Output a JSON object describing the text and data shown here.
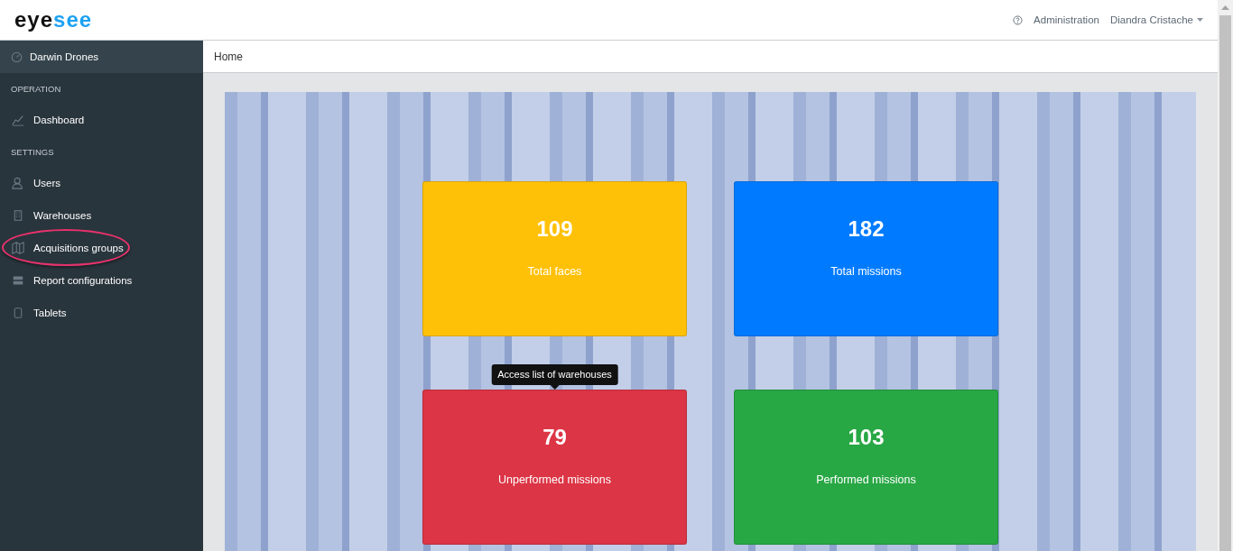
{
  "header": {
    "logo": {
      "dark": "eye",
      "accent": "see"
    },
    "links": [
      "Administration"
    ],
    "user": "Diandra Cristache"
  },
  "sidebar": {
    "organization": "Darwin Drones",
    "items": [
      {
        "kind": "section",
        "label": "OPERATION"
      },
      {
        "kind": "link",
        "label": "Dashboard",
        "highlighted": false
      },
      {
        "kind": "section",
        "label": "SETTINGS"
      },
      {
        "kind": "link",
        "label": "Users",
        "highlighted": false
      },
      {
        "kind": "link",
        "label": "Warehouses",
        "highlighted": false
      },
      {
        "kind": "link",
        "label": "Acquisitions groups",
        "highlighted": true
      },
      {
        "kind": "link",
        "label": "Report configurations",
        "highlighted": false
      },
      {
        "kind": "link",
        "label": "Tablets",
        "highlighted": false
      }
    ]
  },
  "breadcrumb": "Home",
  "cards": [
    {
      "value": "109",
      "label": "Total faces",
      "color": "#ffc107"
    },
    {
      "value": "182",
      "label": "Total missions",
      "color": "#007bff"
    },
    {
      "value": "79",
      "label": "Unperformed missions",
      "color": "#dc3545",
      "tooltip": "Access list of warehouses"
    },
    {
      "value": "103",
      "label": "Performed missions",
      "color": "#28a745"
    }
  ]
}
